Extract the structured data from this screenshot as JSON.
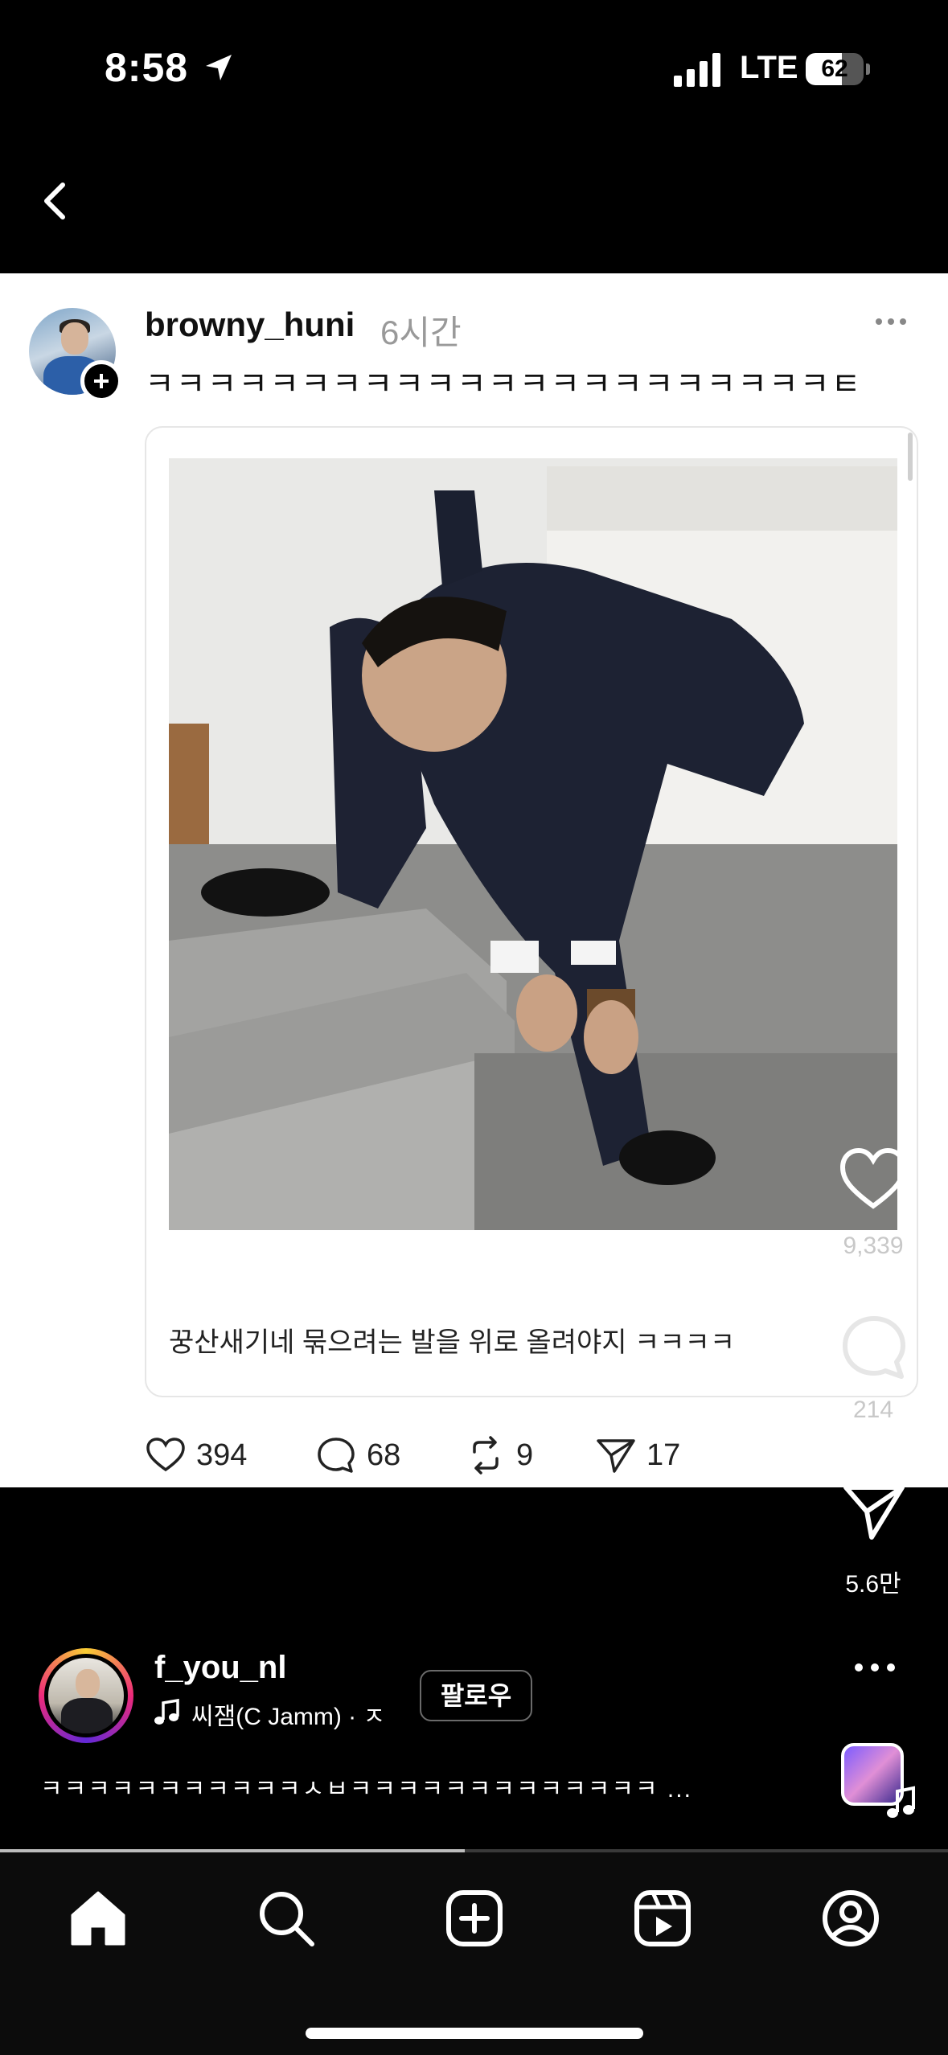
{
  "status_bar": {
    "time": "8:58",
    "network": "LTE",
    "battery_percent": "62",
    "battery_level": 0.62
  },
  "post": {
    "username": "browny_huni",
    "time_ago": "6시간",
    "text": "ㅋㅋㅋㅋㅋㅋㅋㅋㅋㅋㅋㅋㅋㅋㅋㅋㅋㅋㅋㅋㅋㅋㅌ",
    "quote_caption": "꿍산새기네  묶으려는 발을 위로 올려야지  ㅋㅋㅋㅋ",
    "actions": {
      "likes": "394",
      "comments": "68",
      "reposts": "9",
      "shares": "17"
    }
  },
  "reel": {
    "like_count": "9,339",
    "comment_count": "214",
    "share_count": "5.6만",
    "author": "f_you_nl",
    "music": "씨잼(C Jamm) · ㅈ",
    "follow_label": "팔로우",
    "caption": "ㅋㅋㅋㅋㅋㅋㅋㅋㅋㅋㅋㅅㅂㅋㅋㅋㅋㅋㅋㅋㅋㅋㅋㅋㅋㅋ ...",
    "progress": 0.49
  },
  "icons": {
    "back": "chevron-left-icon",
    "home": "home-icon",
    "search": "search-icon",
    "create": "plus-square-icon",
    "reels": "reels-icon",
    "profile": "profile-icon"
  }
}
